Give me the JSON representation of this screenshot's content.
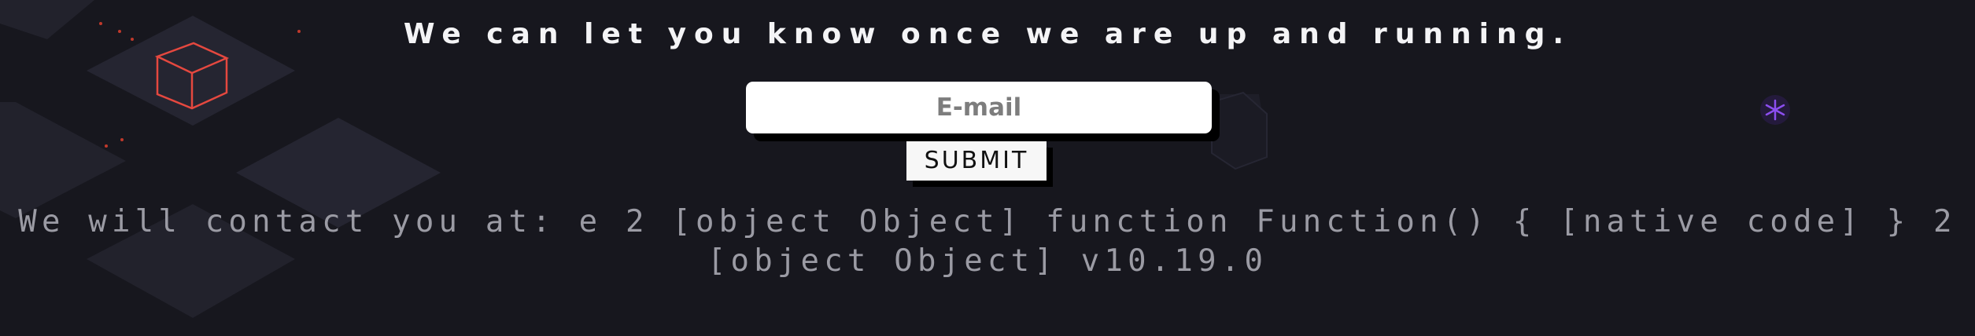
{
  "headline": "We can let you know once we are up and running.",
  "email_field": {
    "placeholder": "E-mail",
    "value": ""
  },
  "submit_label": "SUBMIT",
  "contact_message": {
    "line1": "We will contact you at: e 2 [object Object] function Function() { [native code] } 2",
    "line2": "[object Object] v10.19.0"
  },
  "colors": {
    "background": "#17171e",
    "tile": "#23232e",
    "cube_outline": "#e5483f",
    "accent_sparkle": "#8c4ef0"
  }
}
